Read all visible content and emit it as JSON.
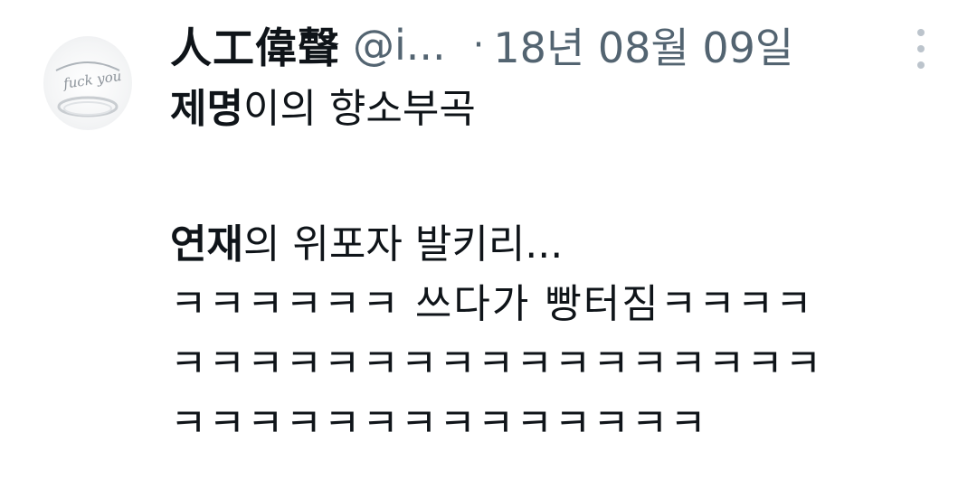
{
  "tweet": {
    "display_name": "人工偉聲",
    "handle": "@i...",
    "separator": "·",
    "date": "18년 08월 09일",
    "avatar_text": "fuck you",
    "lines": [
      {
        "bold": "제명",
        "rest": "이의 향소부곡"
      },
      {
        "bold": "연재",
        "rest": "의 위포자 발키리..."
      },
      {
        "text": "ㅋㅋㅋㅋㅋㅋ 쓰다가 빵터짐ㅋㅋㅋㅋ"
      },
      {
        "text": "ㅋㅋㅋㅋㅋㅋㅋㅋㅋㅋㅋㅋㅋㅋㅋㅋㅋ"
      },
      {
        "text": "ㅋㅋㅋㅋㅋㅋㅋㅋㅋㅋㅋㅋㅋㅋ"
      }
    ]
  },
  "icons": {
    "avatar": "ring-avatar-icon",
    "more": "more-vertical-icon"
  },
  "colors": {
    "text": "#0f1419",
    "secondary": "#536471",
    "dots": "#bcc4cc"
  }
}
